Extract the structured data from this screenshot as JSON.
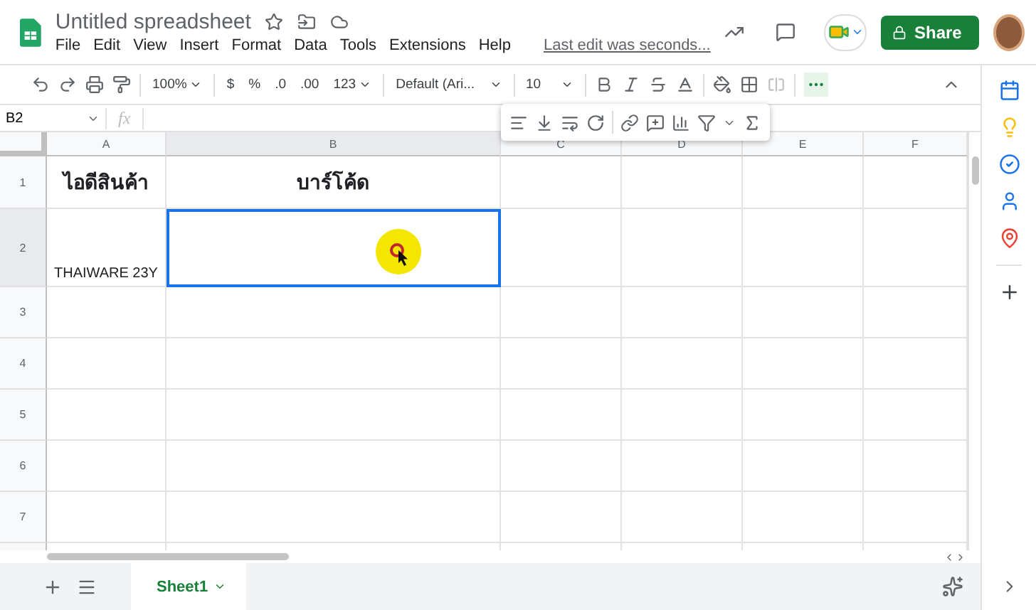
{
  "title": "Untitled spreadsheet",
  "menu": [
    "File",
    "Edit",
    "View",
    "Insert",
    "Format",
    "Data",
    "Tools",
    "Extensions",
    "Help"
  ],
  "last_edit": "Last edit was seconds...",
  "share": "Share",
  "toolbar": {
    "zoom": "100%",
    "currency": "$",
    "percent": "%",
    "decrease_decimal": ".0",
    "increase_decimal": ".00",
    "number_format": "123",
    "font": "Default (Ari...",
    "font_size": "10",
    "more_expanded": true
  },
  "cell_ref": "B2",
  "formula_label": "fx",
  "columns": [
    {
      "label": "A",
      "selected": false
    },
    {
      "label": "B",
      "selected": true
    },
    {
      "label": "C",
      "selected": false
    },
    {
      "label": "D",
      "selected": false
    },
    {
      "label": "E",
      "selected": false
    },
    {
      "label": "F",
      "selected": false
    }
  ],
  "rows": [
    {
      "label": "1",
      "selected": false,
      "cells": [
        {
          "text": "ไอดีสินค้า",
          "bold": true,
          "selected": false
        },
        {
          "text": "บาร์โค้ด",
          "bold": true,
          "selected": false
        }
      ]
    },
    {
      "label": "2",
      "selected": true,
      "cells": [
        {
          "text": "THAIWARE 23Y",
          "bold": false,
          "selected": false
        },
        {
          "bold": false,
          "selected": true
        }
      ]
    },
    {
      "label": "3",
      "selected": false,
      "cells": []
    },
    {
      "label": "4",
      "selected": false,
      "cells": []
    },
    {
      "label": "5",
      "selected": false,
      "cells": []
    },
    {
      "label": "6",
      "selected": false,
      "cells": []
    },
    {
      "label": "7",
      "selected": false,
      "cells": []
    }
  ],
  "sheets": [
    {
      "label": "Sheet1",
      "selected": true
    }
  ]
}
